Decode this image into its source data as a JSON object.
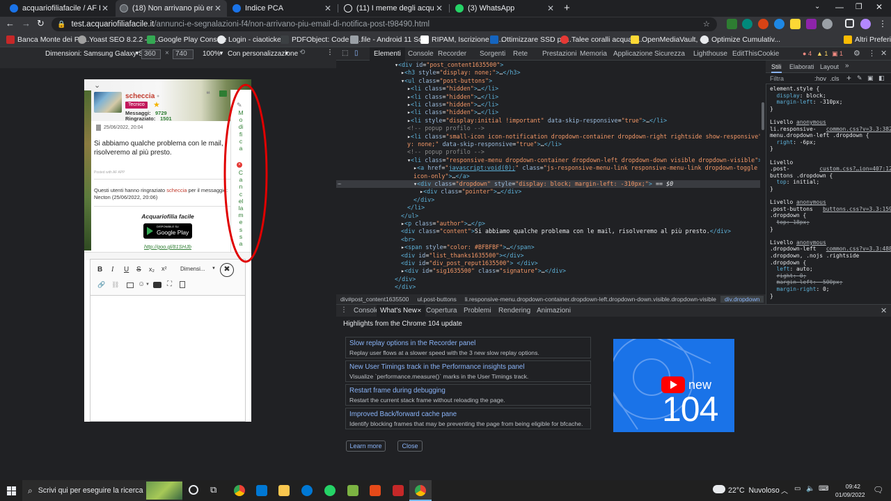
{
  "tabs": [
    {
      "title": "acquariofiliafacile / AF Forum / c",
      "icon_color": "#1a73e8"
    },
    {
      "title": "(18) Non arrivano più email di no",
      "icon_color": "#e8eaed",
      "active": true
    },
    {
      "title": "Indice PCA",
      "icon_color": "#1a73e8"
    },
    {
      "title": "(11) I meme degli acquariofili :D",
      "icon_color": "#e8eaed"
    },
    {
      "title": "(3) WhatsApp",
      "icon_color": "#25d366"
    }
  ],
  "address": {
    "host": "test.acquariofiliafacile.it",
    "path": "/annunci-e-segnalazioni-f4/non-arrivano-piu-email-di-notifica-post-t98490.html"
  },
  "bookmarks": [
    "Banca Monte dei Pa...",
    "Yoast SEO 8.2.2 —...",
    "Google Play Console",
    "Login - ciaotickets",
    "PDFObject: Code G...",
    "file - Android 11 Sc...",
    "RIPAM, Iscrizione ai...",
    "Ottimizzare SSD pe...",
    "Talee coralli acquari...",
    "OpenMediaVault, c...",
    "Optimize Cumulativ...",
    "Altri Preferiti"
  ],
  "device": {
    "label": "Dimensioni: Samsung Galaxy S8+",
    "width": "360",
    "height": "740",
    "zoom": "100%",
    "throttle": "Con personalizzazione"
  },
  "devtools_tabs": [
    "Elementi",
    "Console",
    "Recorder",
    "Sorgenti",
    "Rete",
    "Prestazioni",
    "Memoria",
    "Applicazione",
    "Sicurezza",
    "Lighthouse",
    "EditThisCookie"
  ],
  "devtools_badges": {
    "errors": "4",
    "warnings": "1",
    "issues": "1"
  },
  "post": {
    "username": "scheccia",
    "rank": "Tecnico",
    "messages_label": "Messaggi:",
    "messages": "9729",
    "thanks_label": "Ringraziato:",
    "thanks": "1501",
    "date": "25/06/2022, 20:04",
    "content": "Si abbiamo qualche problema con le mail, risolveremo al più presto.",
    "posted_with": "Posted with AF APP",
    "thanks_text_1": "Questi utenti hanno ringraziato",
    "thanks_user": "scheccia",
    "thanks_text_2": "per il messaggio:",
    "thanks_by": "Necton (25/06/2022, 20:06)",
    "sig_title": "Acquariofilia facile",
    "gp_small": "DISPONIBILE SU",
    "gp_big": "Google Play",
    "sig_link": "http://goo.gl/81SHJb"
  },
  "menu_vertical": {
    "edit": [
      "M",
      "o",
      "di",
      "fi",
      "c",
      "a"
    ],
    "delete": [
      "C",
      "a",
      "n",
      "c",
      "el",
      "la",
      "m",
      "e",
      "s",
      "s",
      "a"
    ]
  },
  "editor": {
    "fontsize_label": "Dimensi..."
  },
  "dom_lines": [
    {
      "indent": 0,
      "html": "▾<span class='tg'>&lt;div</span> <span class='an'>id</span>=<span class='av'>\"post_content1635500\"</span><span class='tg'>&gt;</span>"
    },
    {
      "indent": 1,
      "html": "▸<span class='tg'>&lt;h3</span> <span class='an'>style</span>=<span class='av'>\"display: none;\"</span><span class='tg'>&gt;</span>…<span class='tg'>&lt;/h3&gt;</span>"
    },
    {
      "indent": 1,
      "html": "▾<span class='tg'>&lt;ul</span> <span class='an'>class</span>=<span class='av'>\"post-buttons\"</span><span class='tg'>&gt;</span>"
    },
    {
      "indent": 2,
      "html": "▸<span class='tg'>&lt;li</span> <span class='an'>class</span>=<span class='av'>\"hidden\"</span><span class='tg'>&gt;</span>…<span class='tg'>&lt;/li&gt;</span>"
    },
    {
      "indent": 2,
      "html": "▸<span class='tg'>&lt;li</span> <span class='an'>class</span>=<span class='av'>\"hidden\"</span><span class='tg'>&gt;</span>…<span class='tg'>&lt;/li&gt;</span>"
    },
    {
      "indent": 2,
      "html": "▸<span class='tg'>&lt;li</span> <span class='an'>class</span>=<span class='av'>\"hidden\"</span><span class='tg'>&gt;</span>…<span class='tg'>&lt;/li&gt;</span>"
    },
    {
      "indent": 2,
      "html": "▸<span class='tg'>&lt;li</span> <span class='an'>class</span>=<span class='av'>\"hidden\"</span><span class='tg'>&gt;</span>…<span class='tg'>&lt;/li&gt;</span>"
    },
    {
      "indent": 2,
      "html": "▸<span class='tg'>&lt;li</span> <span class='an'>style</span>=<span class='av'>\"display:initial !important\"</span> <span class='an'>data-skip-responsive</span>=<span class='av'>\"true\"</span><span class='tg'>&gt;</span>…<span class='tg'>&lt;/li&gt;</span>"
    },
    {
      "indent": 2,
      "html": "<span class='cm'>&lt;!-- popup profilo --&gt;</span>"
    },
    {
      "indent": 2,
      "html": "▸<span class='tg'>&lt;li</span> <span class='an'>class</span>=<span class='av'>\"small-icon icon-notification dropdown-container dropdown-right rightside show-responsive\"</span> <span class='an'>style</span>=<span class='av'>\"displa</span>"
    },
    {
      "indent": 2,
      "html": "<span class='av'>y: none;\"</span> <span class='an'>data-skip-responsive</span>=<span class='av'>\"true\"</span><span class='tg'>&gt;</span>…<span class='tg'>&lt;/li&gt;</span>"
    },
    {
      "indent": 2,
      "html": "<span class='cm'>&lt;!-- popup profilo --&gt;</span>"
    },
    {
      "indent": 2,
      "html": "▾<span class='tg'>&lt;li</span> <span class='an'>class</span>=<span class='av'>\"responsive-menu dropdown-container dropdown-left dropdown-down visible dropdown-visible\"</span><span class='tg'>&gt;</span>"
    },
    {
      "indent": 3,
      "html": "▸<span class='tg'>&lt;a</span> <span class='an'>href</span>=<span class='av'>\"<span class='lk'>javascript:void(0);</span>\"</span> <span class='an'>class</span>=<span class='av'>\"js-responsive-menu-link responsive-menu-link dropdown-toggle button button-</span>"
    },
    {
      "indent": 3,
      "html": "<span class='av'>icon-only\"</span><span class='tg'>&gt;</span>…<span class='tg'>&lt;/a&gt;</span>"
    },
    {
      "indent": 3,
      "html": "▾<span class='tg'>&lt;div</span> <span class='an'>class</span>=<span class='av'>\"dropdown\"</span> <span class='an'>style</span>=<span class='av'>\"display: block; margin-left: -310px;\"</span><span class='tg'>&gt;</span> == <i>$0</i>",
      "selected": true
    },
    {
      "indent": 4,
      "html": "▸<span class='tg'>&lt;div</span> <span class='an'>class</span>=<span class='av'>\"pointer\"</span><span class='tg'>&gt;</span>…<span class='tg'>&lt;/div&gt;</span>"
    },
    {
      "indent": 3,
      "html": "<span class='tg'>&lt;/div&gt;</span>"
    },
    {
      "indent": 2,
      "html": "<span class='tg'>&lt;/li&gt;</span>"
    },
    {
      "indent": 1,
      "html": "<span class='tg'>&lt;/ul&gt;</span>"
    },
    {
      "indent": 1,
      "html": "▸<span class='tg'>&lt;p</span> <span class='an'>class</span>=<span class='av'>\"author\"</span><span class='tg'>&gt;</span>…<span class='tg'>&lt;/p&gt;</span>"
    },
    {
      "indent": 1,
      "html": "<span class='tg'>&lt;div</span> <span class='an'>class</span>=<span class='av'>\"content\"</span><span class='tg'>&gt;</span><span class='tx'>Si abbiamo qualche problema con le mail, risolveremo al più presto.</span><span class='tg'>&lt;/div&gt;</span>"
    },
    {
      "indent": 1,
      "html": "<span class='tg'>&lt;br&gt;</span>"
    },
    {
      "indent": 1,
      "html": "▸<span class='tg'>&lt;span</span> <span class='an'>style</span>=<span class='av'>\"color: #BFBFBF\"</span><span class='tg'>&gt;</span>…<span class='tg'>&lt;/span&gt;</span>"
    },
    {
      "indent": 1,
      "html": "<span class='tg'>&lt;div</span> <span class='an'>id</span>=<span class='av'>\"list_thanks1635500\"</span><span class='tg'>&gt;</span><span class='tg'>&lt;/div&gt;</span>"
    },
    {
      "indent": 1,
      "html": "<span class='tg'>&lt;div</span> <span class='an'>id</span>=<span class='av'>\"div_post_reput1635500\"</span><span class='tg'>&gt;</span> <span class='tg'>&lt;/div&gt;</span>"
    },
    {
      "indent": 1,
      "html": "▸<span class='tg'>&lt;div</span> <span class='an'>id</span>=<span class='av'>\"sig1635500\"</span> <span class='an'>class</span>=<span class='av'>\"signature\"</span><span class='tg'>&gt;</span>…<span class='tg'>&lt;/div&gt;</span>"
    },
    {
      "indent": 0,
      "html": "<span class='tg'>&lt;/div&gt;</span>"
    },
    {
      "indent": 0,
      "html": "<span class='tg'>&lt;/div&gt;</span>"
    }
  ],
  "breadcrumbs": [
    "div#post_content1635500",
    "ul.post-buttons",
    "li.responsive-menu.dropdown-container.dropdown-left.dropdown-down.visible.dropdown-visible",
    "div.dropdown"
  ],
  "styles_tabs": [
    "Stili",
    "Elaborati",
    "Layout"
  ],
  "styles_filter": {
    "placeholder": "Filtra",
    "hov": ":hov",
    "cls": ".cls"
  },
  "style_lines": [
    {
      "html": "<span class='sel'>element.style {</span>"
    },
    {
      "html": "&nbsp;&nbsp;<span class='pn'>display</span>: <span class='pv'>block;</span>"
    },
    {
      "html": "&nbsp;&nbsp;<span class='pn'>margin-left</span>: <span class='pv'>-310px;</span>"
    },
    {
      "html": "<span class='sel'>}</span>"
    },
    {
      "html": ""
    },
    {
      "html": "<span class='pv'>Livello</span> <span class='src'>anonymous</span>"
    },
    {
      "html": "<span class='sel'>li.responsive-</span>&nbsp;&nbsp;&nbsp;<span class='src'>common.css?v=3.3:382</span>"
    },
    {
      "html": "<span class='sel'>menu.dropdown-left .dropdown {</span>"
    },
    {
      "html": "&nbsp;&nbsp;<span class='pn'>right</span>: <span class='pv'>-6px;</span>"
    },
    {
      "html": "<span class='sel'>}</span>"
    },
    {
      "html": ""
    },
    {
      "html": "<span class='pv'>Livello</span>"
    },
    {
      "html": "<span class='sel'>.post-</span>&nbsp;&nbsp;&nbsp;&nbsp;&nbsp;&nbsp;&nbsp;&nbsp;&nbsp;<span class='src'>custom.css?…ion=407:125</span>"
    },
    {
      "html": "<span class='sel'>buttons .dropdown {</span>"
    },
    {
      "html": "&nbsp;&nbsp;<span class='pn'>top</span>: <span class='pv'>initial;</span>"
    },
    {
      "html": "<span class='sel'>}</span>"
    },
    {
      "html": ""
    },
    {
      "html": "<span class='pv'>Livello</span> <span class='src'>anonymous</span>"
    },
    {
      "html": "<span class='sel'>.post-buttons</span>&nbsp;&nbsp;&nbsp;<span class='src'>buttons.css?v=3.3:159</span>"
    },
    {
      "html": "<span class='sel'>.dropdown {</span>"
    },
    {
      "html": "&nbsp;&nbsp;<span class='strk'>top: 18px;</span>"
    },
    {
      "html": "<span class='sel'>}</span>"
    },
    {
      "html": ""
    },
    {
      "html": "<span class='pv'>Livello</span> <span class='src'>anonymous</span>"
    },
    {
      "html": "<span class='sel'>.dropdown-left</span>&nbsp;&nbsp;&nbsp;<span class='src'>common.css?v=3.3:488</span>"
    },
    {
      "html": "<span class='sel'>.dropdown, .nojs .rightside</span>"
    },
    {
      "html": "<span class='sel'>.dropdown {</span>"
    },
    {
      "html": "&nbsp;&nbsp;<span class='pn'>left</span>: <span class='pv'>auto;</span>"
    },
    {
      "html": "&nbsp;&nbsp;<span class='strk'>right: 0;</span>"
    },
    {
      "html": "&nbsp;&nbsp;<span class='strk'>margin-left: -500px;</span>"
    },
    {
      "html": "&nbsp;&nbsp;<span class='pn'>margin-right</span>: <span class='pv'>0;</span>"
    },
    {
      "html": "<span class='sel'>}</span>"
    }
  ],
  "drawer_tabs": [
    "Console",
    "What's New",
    "Copertura",
    "Problemi",
    "Rendering",
    "Animazioni"
  ],
  "whatsnew": {
    "header": "Highlights from the Chrome 104 update",
    "items": [
      {
        "title": "Slow replay options in the Recorder panel",
        "desc": "Replay user flows at a slower speed with the 3 new slow replay options."
      },
      {
        "title": "New User Timings track in the Performance insights panel",
        "desc": "Visualize `performance.measure()` marks in the User Timings track."
      },
      {
        "title": "Restart frame during debugging",
        "desc": "Restart the current stack frame without reloading the page."
      },
      {
        "title": "Improved Back/forward cache pane",
        "desc": "Identify blocking frames that may be preventing the page from being eligible for bfcache."
      }
    ],
    "learn_more": "Learn more",
    "close": "Close",
    "banner_new": "new",
    "banner_num": "104"
  },
  "taskbar": {
    "search_placeholder": "Scrivi qui per eseguire la ricerca",
    "weather": "22°C  Nuvoloso",
    "time": "09:42",
    "date": "01/09/2022"
  }
}
